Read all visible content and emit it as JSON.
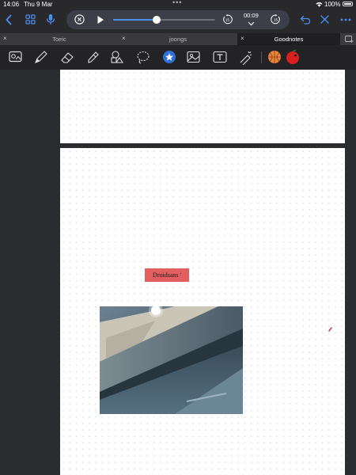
{
  "status_bar": {
    "time": "14:06",
    "date": "Thu 9 Mar",
    "battery": "100%"
  },
  "audio_player": {
    "elapsed": "00:09",
    "progress": 0.43,
    "skip_back_label": "15",
    "skip_forward_label": "15"
  },
  "tabs": [
    {
      "label": "Toeic",
      "active": false
    },
    {
      "label": "joongs",
      "active": false
    },
    {
      "label": "Goodnotes",
      "active": true
    }
  ],
  "toolbar": {
    "tools": [
      "image-text-icon",
      "pen-icon",
      "eraser-icon",
      "highlighter-icon",
      "shapes-icon",
      "lasso-icon",
      "elements-icon",
      "image-icon",
      "text-box-icon",
      "laser-pointer-icon"
    ],
    "active_tool": "elements-icon",
    "accent_color": "#2f6fd9"
  },
  "document": {
    "text_box": "Droidsans '",
    "text_box_color": "#e35f5f"
  }
}
